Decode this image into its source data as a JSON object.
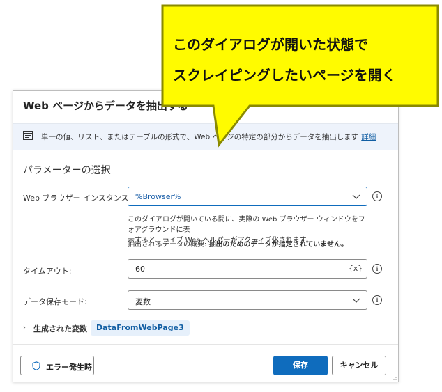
{
  "dialog": {
    "title": "Web ページからデータを抽出する",
    "info_text": "単一の値、リスト、またはテーブルの形式で、Web ページの特定の部分からデータを抽出します",
    "info_link": "詳細",
    "section_title": "パラメーターの選択",
    "browser_label": "Web ブラウザー インスタンス:",
    "browser_value": "%Browser%",
    "desc_line1": "このダイアログが開いている間に、実際の Web ブラウザー ウィンドウをフォアグラウンドに表",
    "desc_line2": "示すると、ライブ Web ヘルパーがアクティブ化されます。",
    "summary_prefix": "抽出されるデータの概要:",
    "summary_value": "抽出のためのデータが指定されていません。",
    "timeout_label": "タイムアウト:",
    "timeout_value": "60",
    "timeout_var_symbol": "{x}",
    "store_mode_label": "データ保存モード:",
    "store_mode_value": "変数",
    "generated_label": "生成された変数",
    "generated_var": "DataFromWebPage3",
    "on_error_label": "エラー発生時",
    "save_label": "保存",
    "cancel_label": "キャンセル"
  },
  "callout": {
    "line1": "このダイアログが開いた状態で",
    "line2": "スクレイピングしたいページを開く",
    "fill_color": "#fffb00",
    "border_color": "#8a8a00"
  },
  "colors": {
    "accent": "#0f6cbd",
    "link": "#115ea3",
    "info_bg": "#eef3fb"
  }
}
